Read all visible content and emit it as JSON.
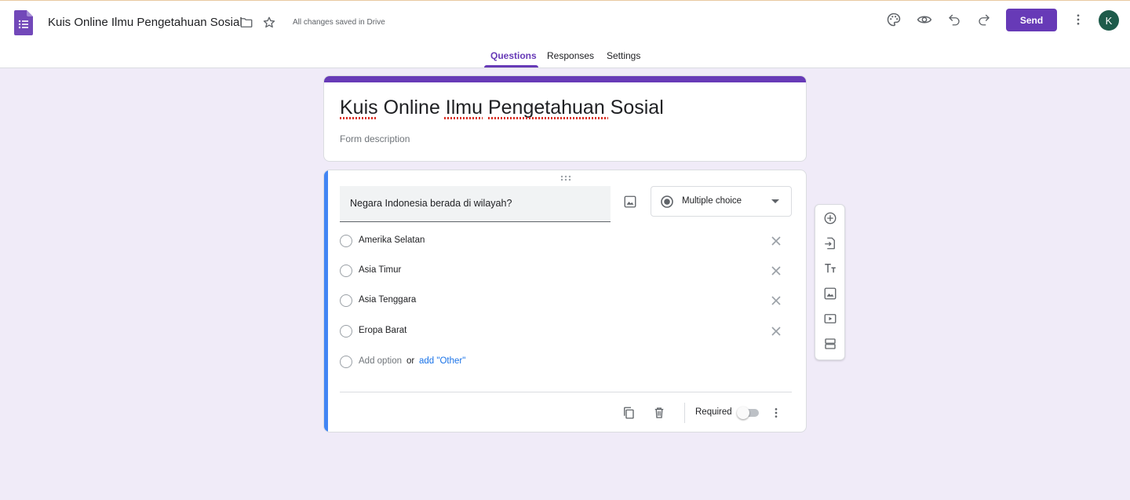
{
  "header": {
    "doc_title": "Kuis Online Ilmu Pengetahuan Sosial",
    "save_status": "All changes saved in Drive",
    "send_label": "Send",
    "avatar_initial": "K",
    "icons": [
      "palette-icon",
      "preview-eye-icon",
      "undo-icon",
      "redo-icon",
      "more-vert-icon"
    ],
    "accent_color": "#673ab7"
  },
  "tabs": [
    {
      "label": "Questions",
      "active": true
    },
    {
      "label": "Responses",
      "active": false
    },
    {
      "label": "Settings",
      "active": false
    }
  ],
  "form": {
    "title": "Kuis Online Ilmu Pengetahuan Sosial",
    "description_placeholder": "Form description"
  },
  "question": {
    "text": "Negara Indonesia berada di wilayah?",
    "type": "Multiple choice",
    "options": [
      {
        "label": "Amerika Selatan"
      },
      {
        "label": "Asia Timur"
      },
      {
        "label": "Asia Tenggara"
      },
      {
        "label": "Eropa Barat"
      }
    ],
    "add_option": "Add option",
    "or": "or",
    "add_other": "add \"Other\"",
    "required_label": "Required",
    "required": false,
    "accent_color": "#4285f4"
  },
  "side_toolbar": {
    "icons": [
      "add-question-icon",
      "import-questions-icon",
      "add-title-icon",
      "add-image-icon",
      "add-video-icon",
      "add-section-icon"
    ]
  }
}
